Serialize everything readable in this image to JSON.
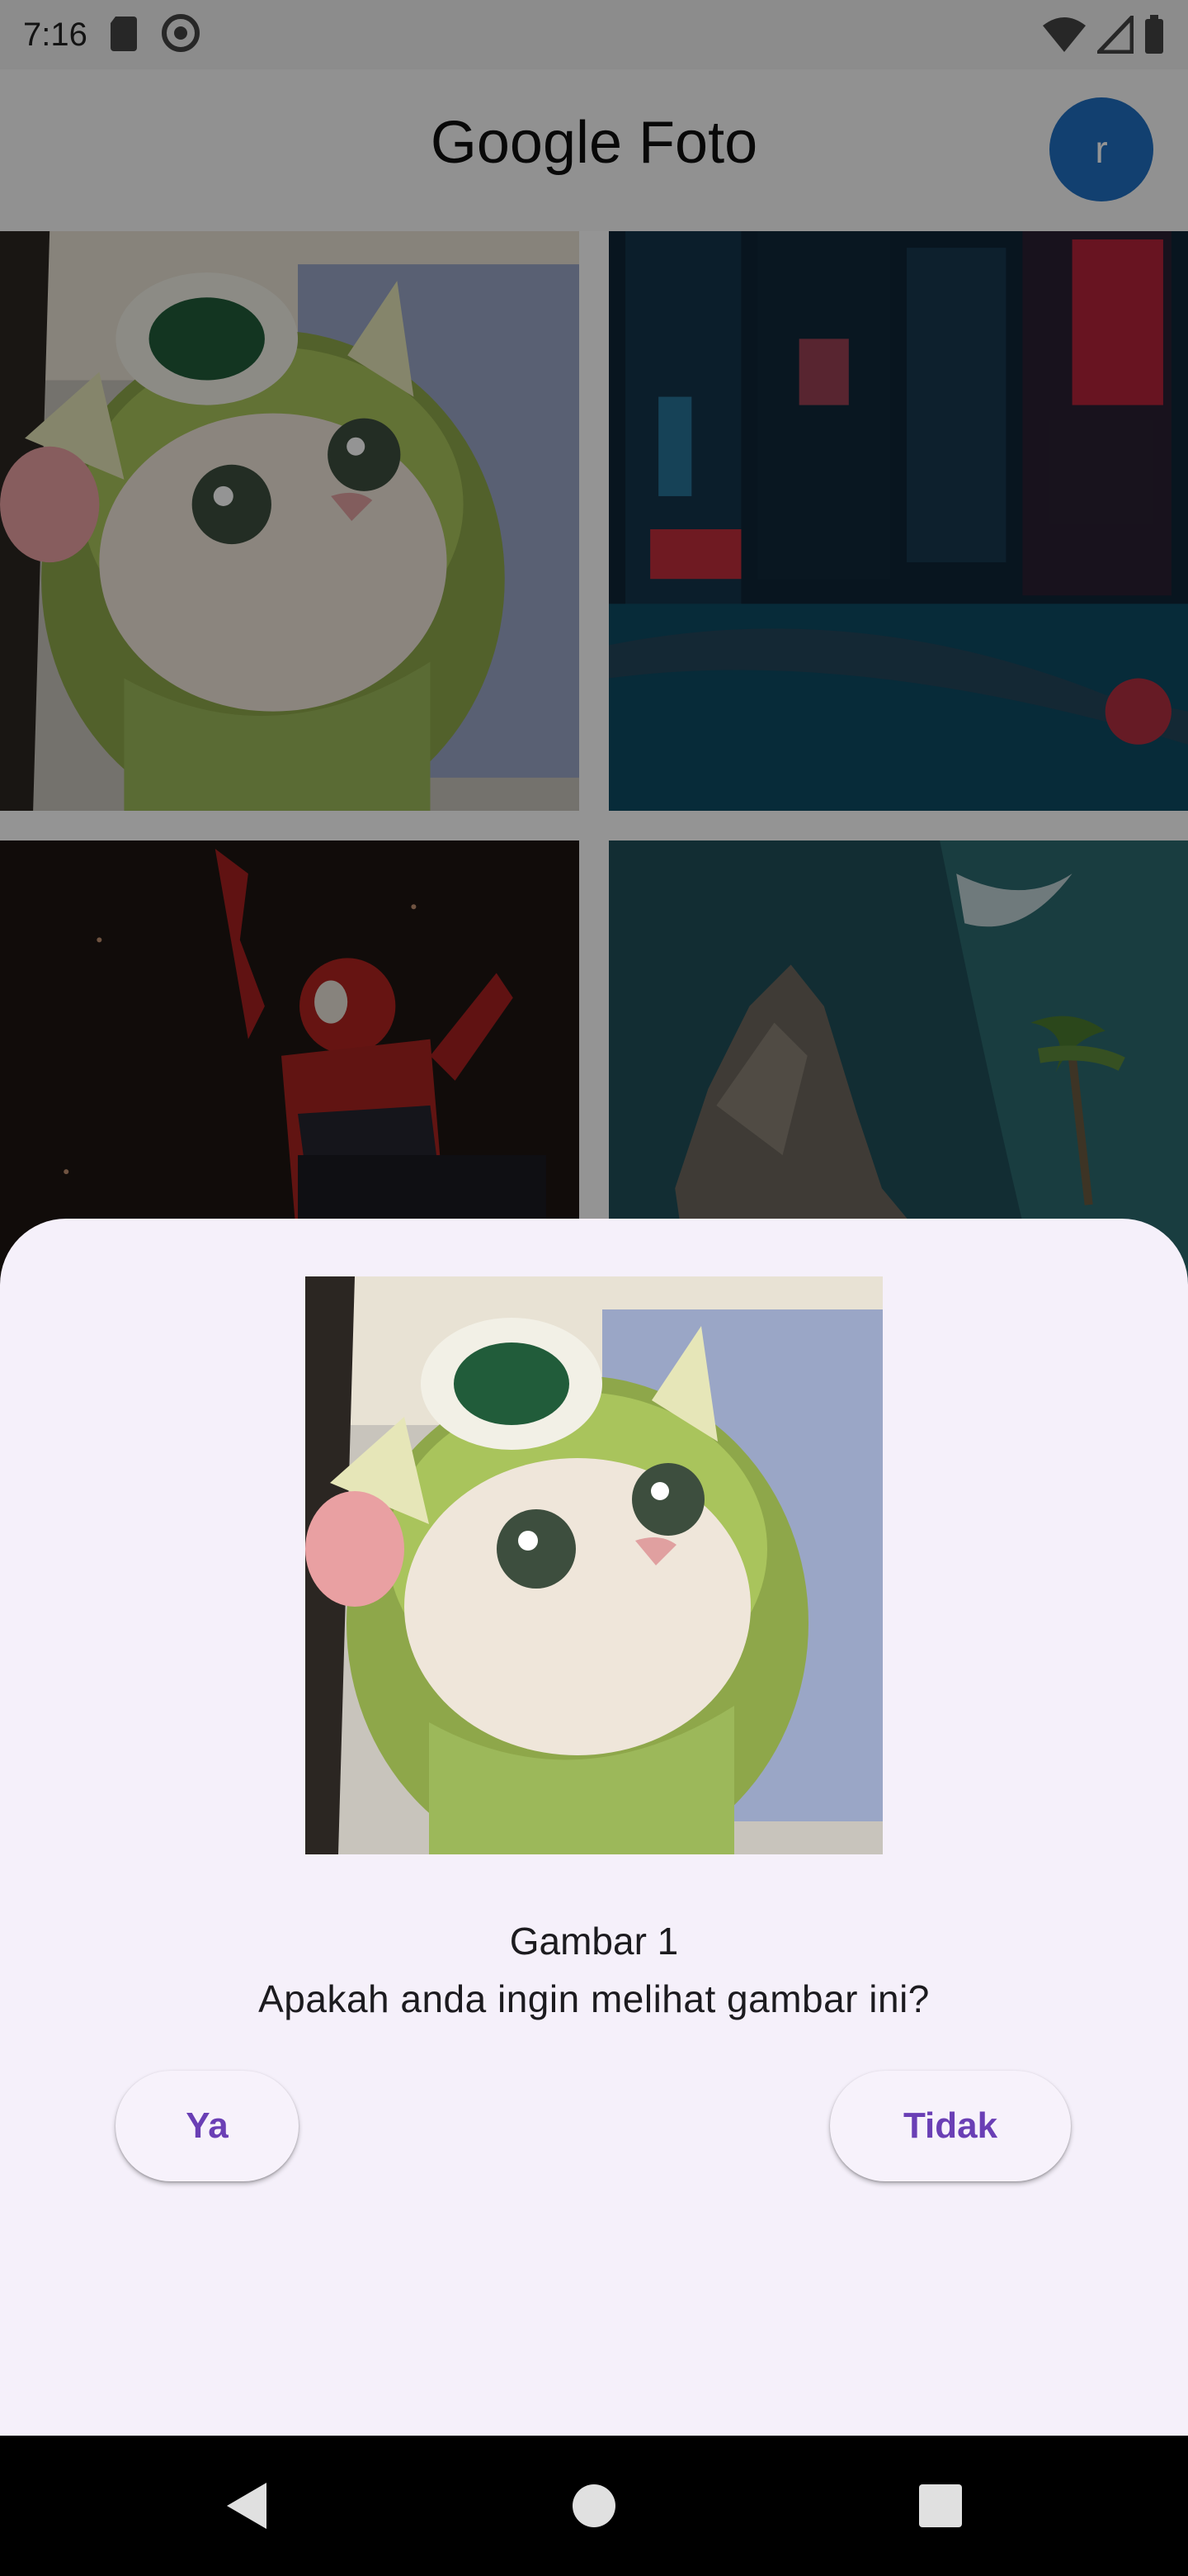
{
  "status_bar": {
    "time": "7:16",
    "icons": [
      "sd-card-icon",
      "do-not-disturb-icon",
      "wifi-icon",
      "cell-signal-icon",
      "battery-icon"
    ]
  },
  "app_bar": {
    "title": "Google Foto",
    "avatar_initial": "r",
    "avatar_color": "#1f6fc2"
  },
  "grid": {
    "items": [
      {
        "subject": "cat in green monster hat"
      },
      {
        "subject": "neon city at night"
      },
      {
        "subject": "spider-man figure"
      },
      {
        "subject": "coastal rock with palm trees"
      }
    ]
  },
  "dialog": {
    "title": "Gambar 1",
    "question": "Apakah anda ingin melihat gambar ini?",
    "yes_label": "Ya",
    "no_label": "Tidak",
    "accent_color": "#6a3fb5",
    "background_color": "#f5f0fa"
  },
  "nav_bar": {
    "buttons": [
      "back-icon",
      "home-icon",
      "recents-icon"
    ]
  }
}
